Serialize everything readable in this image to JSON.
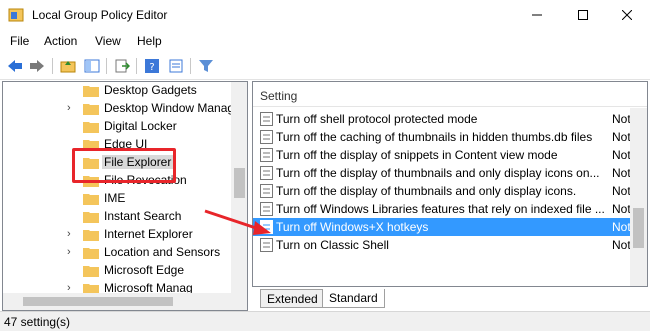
{
  "window": {
    "title": "Local Group Policy Editor"
  },
  "menu": [
    "File",
    "Action",
    "View",
    "Help"
  ],
  "tree": {
    "items": [
      {
        "label": "Desktop Gadgets",
        "expandable": false
      },
      {
        "label": "Desktop Window Manag",
        "expandable": true
      },
      {
        "label": "Digital Locker",
        "expandable": false
      },
      {
        "label": "Edge UI",
        "expandable": false
      },
      {
        "label": "File Explorer",
        "expandable": false,
        "selected": true
      },
      {
        "label": "File Revocation",
        "expandable": false
      },
      {
        "label": "IME",
        "expandable": false
      },
      {
        "label": "Instant Search",
        "expandable": false
      },
      {
        "label": "Internet Explorer",
        "expandable": true
      },
      {
        "label": "Location and Sensors",
        "expandable": true
      },
      {
        "label": "Microsoft Edge",
        "expandable": false
      },
      {
        "label": "Microsoft Manag",
        "expandable": true
      }
    ]
  },
  "settings": {
    "column_header": "Setting",
    "rows": [
      {
        "label": "Turn off shell protocol protected mode",
        "state": "Not"
      },
      {
        "label": "Turn off the caching of thumbnails in hidden thumbs.db files",
        "state": "Not"
      },
      {
        "label": "Turn off the display of snippets in Content view mode",
        "state": "Not"
      },
      {
        "label": "Turn off the display of thumbnails and only display icons on...",
        "state": "Not"
      },
      {
        "label": "Turn off the display of thumbnails and only display icons.",
        "state": "Not"
      },
      {
        "label": "Turn off Windows Libraries features that rely on indexed file ...",
        "state": "Not"
      },
      {
        "label": "Turn off Windows+X hotkeys",
        "state": "Not",
        "selected": true
      },
      {
        "label": "Turn on Classic Shell",
        "state": "Not"
      }
    ]
  },
  "tabs": {
    "extended": "Extended",
    "standard": "Standard",
    "active": "Standard"
  },
  "status": {
    "text": "47 setting(s)"
  },
  "colors": {
    "selection": "#3399ff",
    "annotation": "#e8252a",
    "folder": "#f4c55b"
  }
}
